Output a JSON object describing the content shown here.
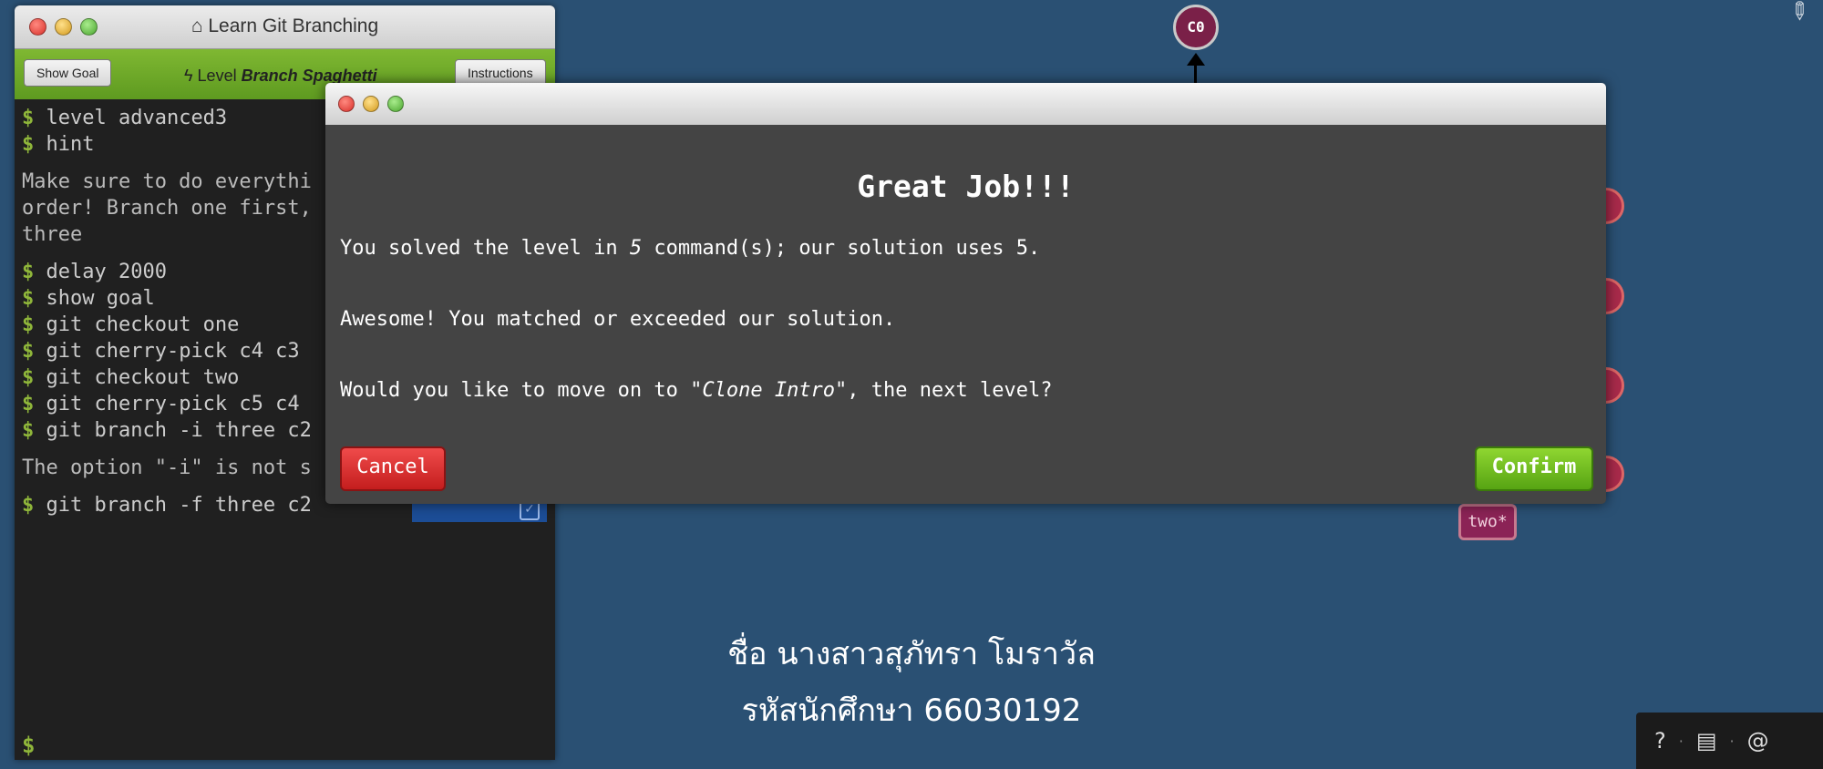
{
  "terminal": {
    "title": "Learn Git Branching",
    "show_goal_label": "Show Goal",
    "level_prefix": "Level",
    "level_name": "Branch Spaghetti",
    "instructions_label": "Instructions",
    "prompt": "$",
    "lines": [
      {
        "type": "cmd",
        "text": "level advanced3"
      },
      {
        "type": "cmd",
        "text": "hint"
      },
      {
        "type": "result",
        "text": "Make sure to do everythi\norder! Branch one first,\nthree"
      },
      {
        "type": "cmd",
        "text": "delay 2000"
      },
      {
        "type": "cmd",
        "text": "show goal"
      },
      {
        "type": "cmd",
        "text": "git checkout one"
      },
      {
        "type": "cmd",
        "text": "git cherry-pick c4 c3"
      },
      {
        "type": "cmd",
        "text": "git checkout two"
      },
      {
        "type": "cmd",
        "text": "git cherry-pick c5 c4"
      },
      {
        "type": "cmd",
        "text": "git branch -i three c2"
      },
      {
        "type": "result",
        "text": "The option \"-i\" is not s"
      },
      {
        "type": "cmd",
        "text": "git branch -f three c2"
      }
    ]
  },
  "visual": {
    "top_commit": "C0",
    "branch_label": "two*"
  },
  "student": {
    "name": "ชื่อ นางสาวสุภัทรา โมราวัล",
    "id": "รหัสนักศึกษา 66030192"
  },
  "helpbar": {
    "help_icon": "?",
    "sep1": "·",
    "sep2": "·"
  },
  "modal": {
    "heading": "Great Job!!!",
    "line1_prefix": "You solved the level in ",
    "line1_count": "5",
    "line1_suffix": " command(s); our solution uses 5.",
    "line2": "Awesome! You matched or exceeded our solution.",
    "line3_prefix": "Would you like to move on to ",
    "line3_level": "\"Clone Intro\"",
    "line3_suffix": ", the next level?",
    "cancel_label": "Cancel",
    "confirm_label": "Confirm"
  }
}
